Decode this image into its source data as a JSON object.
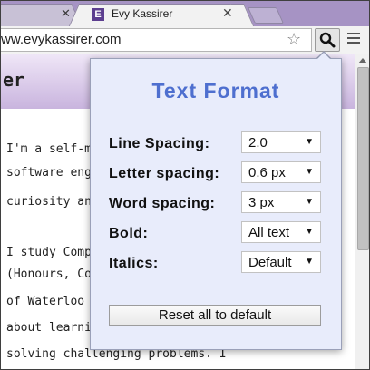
{
  "browser": {
    "active_tab_title": "Evy Kassirer",
    "favicon_letter": "E",
    "url": "ww.evykassirer.com"
  },
  "page": {
    "header_text": "er",
    "lines": [
      "I'm a self-mo",
      "software eng",
      "curiosity and",
      "I study Comp",
      "(Honours, Co",
      "of Waterloo",
      "about learnin",
      "solving challenging problems. I"
    ]
  },
  "popup": {
    "title": "Text Format",
    "rows": [
      {
        "label": "Line Spacing:",
        "value": "2.0"
      },
      {
        "label": "Letter spacing:",
        "value": "0.6 px"
      },
      {
        "label": "Word spacing:",
        "value": "3 px"
      },
      {
        "label": "Bold:",
        "value": "All text"
      },
      {
        "label": "Italics:",
        "value": "Default"
      }
    ],
    "reset_label": "Reset all to default"
  },
  "colors": {
    "tabstrip": "#a693c4",
    "popup_bg": "#e8ecfb",
    "title_accent": "#4e6fcf",
    "favicon": "#5c3e8f"
  },
  "icons": [
    "close-icon",
    "star-icon",
    "search-icon",
    "menu-icon",
    "dropdown-arrow-icon"
  ]
}
